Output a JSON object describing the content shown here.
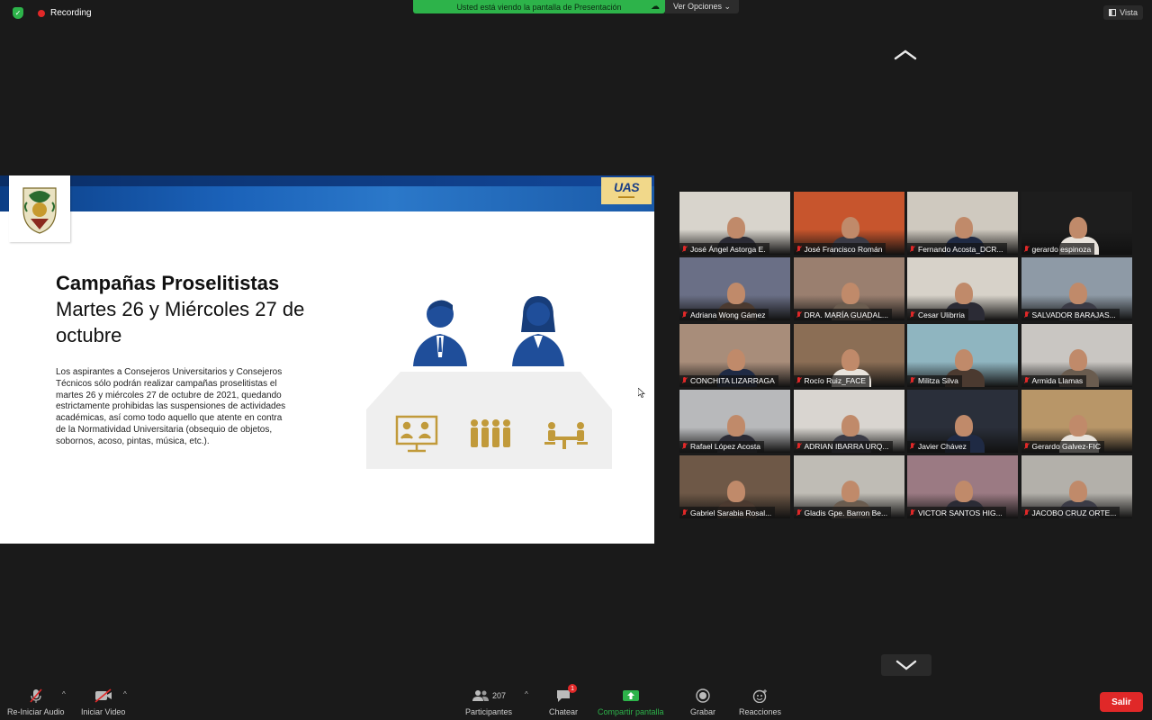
{
  "top": {
    "recording_label": "Recording",
    "share_banner": "Usted está viendo la pantalla de Presentación",
    "view_options": "Ver Opciones ⌄",
    "vista_label": "Vista"
  },
  "slide": {
    "logo_text": "UAS",
    "logo_sub": "",
    "title": "Campañas Proselitistas",
    "subtitle": "Martes 26 y Miércoles 27 de octubre",
    "body": "Los aspirantes a Consejeros Universitarios y Consejeros Técnicos sólo podrán realizar campañas proselitistas el martes 26 y miércoles 27 de octubre de 2021, quedando estrictamente prohibidas las suspensiones de actividades académicas, así como todo aquello que atente en contra de la Normatividad Universitaria (obsequio de objetos, sobornos, acoso, pintas, música, etc.)."
  },
  "gallery": [
    {
      "name": "José Ángel Astorga E.",
      "bg": "#d8d4cc"
    },
    {
      "name": "José Francisco Román",
      "bg": "#c7552d"
    },
    {
      "name": "Fernando Acosta_DCR...",
      "bg": "#cfc9bf"
    },
    {
      "name": "gerardo espinoza",
      "bg": "#1d1d1d"
    },
    {
      "name": "Adriana Wong Gámez",
      "bg": "#6a6f86"
    },
    {
      "name": "DRA. MARÍA GUADAL...",
      "bg": "#9a7f6f"
    },
    {
      "name": "Cesar Ulibrria",
      "bg": "#d7d2c9"
    },
    {
      "name": "SALVADOR BARAJAS...",
      "bg": "#8e9aa6"
    },
    {
      "name": "CONCHITA LIZARRAGA",
      "bg": "#a88d7a"
    },
    {
      "name": "Rocío Ruiz_FACE",
      "bg": "#8b6e55"
    },
    {
      "name": "Militza Silva",
      "bg": "#8fb5c0"
    },
    {
      "name": "Armida Llamas",
      "bg": "#c9c6c2"
    },
    {
      "name": "Rafael López Acosta",
      "bg": "#b8b9bb"
    },
    {
      "name": "ADRIAN IBARRA URQ...",
      "bg": "#d9d5d0"
    },
    {
      "name": "Javier Chávez",
      "bg": "#2a2f3a"
    },
    {
      "name": "Gerardo Galvez-FIC",
      "bg": "#b89668"
    },
    {
      "name": "Gabriel Sarabia Rosal...",
      "bg": "#6e5847"
    },
    {
      "name": "Gladis Gpe. Barron Be...",
      "bg": "#bfbcb5"
    },
    {
      "name": "VICTOR SANTOS HIG...",
      "bg": "#9b7a83"
    },
    {
      "name": "JACOBO CRUZ ORTE...",
      "bg": "#b3b0aa"
    }
  ],
  "toolbar": {
    "audio_label": "Re-Iniciar Audio",
    "video_label": "Iniciar Video",
    "participants_count": "207",
    "participants_label": "Participantes",
    "chat_badge": "1",
    "chat_label": "Chatear",
    "share_label": "Compartir pantalla",
    "record_label": "Grabar",
    "reactions_label": "Reacciones",
    "leave_label": "Salir"
  },
  "colors": {
    "share_green": "#2db34a",
    "leave_red": "#e02828",
    "slide_blue": "#1b62b9",
    "gold": "#c19a3a"
  }
}
